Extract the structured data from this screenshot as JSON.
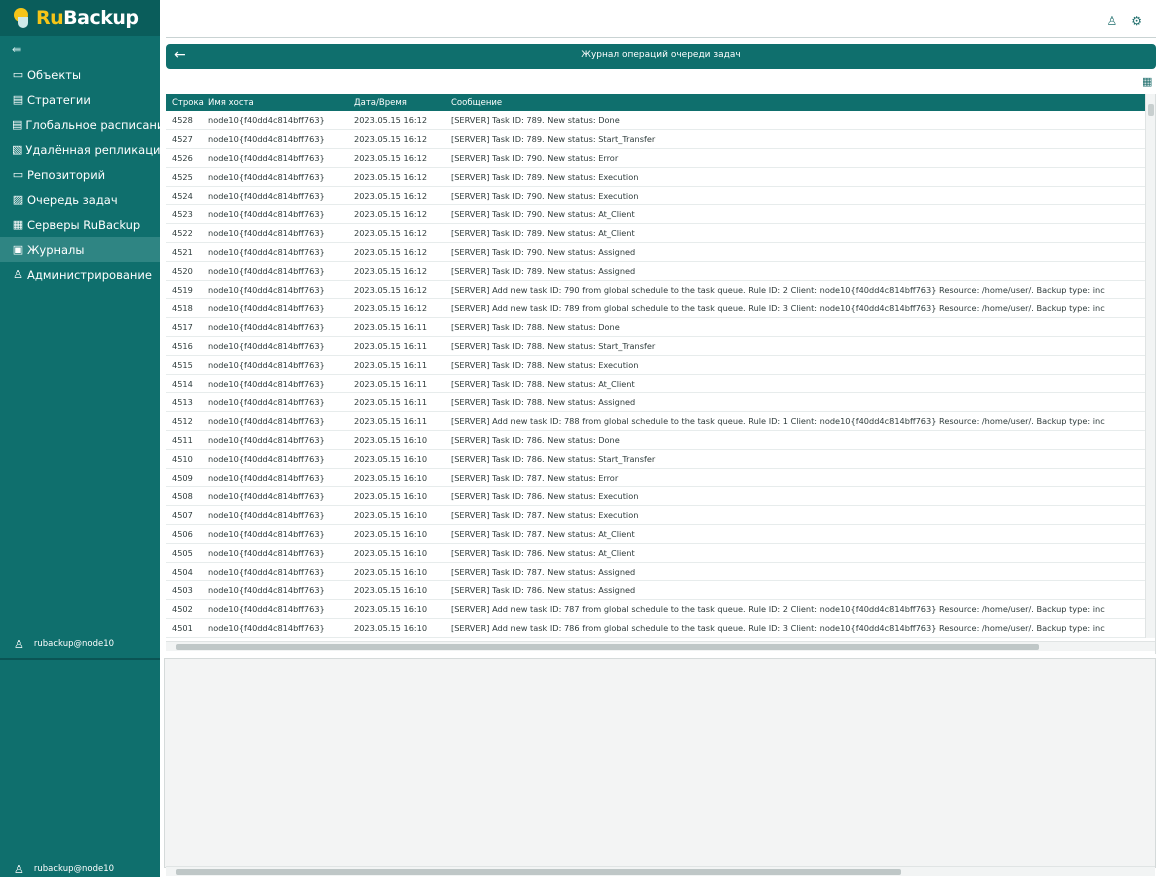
{
  "app": {
    "logo_ru": "Ru",
    "logo_backup": "Backup"
  },
  "sidebar": {
    "collapse_glyph": "⇚",
    "items": [
      {
        "icon": "monitor-icon",
        "glyph": "▭",
        "label": "Объекты"
      },
      {
        "icon": "strategy-icon",
        "glyph": "▤",
        "label": "Стратегии"
      },
      {
        "icon": "calendar-icon",
        "glyph": "▤",
        "label": "Глобальное расписание"
      },
      {
        "icon": "replication-icon",
        "glyph": "▧",
        "label": "Удалённая репликация"
      },
      {
        "icon": "repository-icon",
        "glyph": "▭",
        "label": "Репозиторий"
      },
      {
        "icon": "queue-icon",
        "glyph": "▨",
        "label": "Очередь задач"
      },
      {
        "icon": "servers-icon",
        "glyph": "▦",
        "label": "Серверы RuBackup"
      },
      {
        "icon": "journal-icon",
        "glyph": "▣",
        "label": "Журналы"
      },
      {
        "icon": "admin-icon",
        "glyph": "♙",
        "label": "Администрирование"
      }
    ],
    "user": "rubackup@node10"
  },
  "header": {
    "title": "Журнал операций очереди задач"
  },
  "table": {
    "columns": [
      "Строка",
      "Имя хоста",
      "Дата/Время",
      "Сообщение"
    ],
    "rows": [
      [
        "4528",
        "node10{f40dd4c814bff763}",
        "2023.05.15 16:12",
        "[SERVER] Task ID: 789. New status: Done"
      ],
      [
        "4527",
        "node10{f40dd4c814bff763}",
        "2023.05.15 16:12",
        "[SERVER] Task ID: 789. New status: Start_Transfer"
      ],
      [
        "4526",
        "node10{f40dd4c814bff763}",
        "2023.05.15 16:12",
        "[SERVER] Task ID: 790. New status: Error"
      ],
      [
        "4525",
        "node10{f40dd4c814bff763}",
        "2023.05.15 16:12",
        "[SERVER] Task ID: 789. New status: Execution"
      ],
      [
        "4524",
        "node10{f40dd4c814bff763}",
        "2023.05.15 16:12",
        "[SERVER] Task ID: 790. New status: Execution"
      ],
      [
        "4523",
        "node10{f40dd4c814bff763}",
        "2023.05.15 16:12",
        "[SERVER] Task ID: 790. New status: At_Client"
      ],
      [
        "4522",
        "node10{f40dd4c814bff763}",
        "2023.05.15 16:12",
        "[SERVER] Task ID: 789. New status: At_Client"
      ],
      [
        "4521",
        "node10{f40dd4c814bff763}",
        "2023.05.15 16:12",
        "[SERVER] Task ID: 790. New status: Assigned"
      ],
      [
        "4520",
        "node10{f40dd4c814bff763}",
        "2023.05.15 16:12",
        "[SERVER] Task ID: 789. New status: Assigned"
      ],
      [
        "4519",
        "node10{f40dd4c814bff763}",
        "2023.05.15 16:12",
        "[SERVER] Add new task ID: 790 from global schedule to the task queue. Rule ID: 2 Client: node10{f40dd4c814bff763} Resource: /home/user/. Backup type: inc"
      ],
      [
        "4518",
        "node10{f40dd4c814bff763}",
        "2023.05.15 16:12",
        "[SERVER] Add new task ID: 789 from global schedule to the task queue. Rule ID: 3 Client: node10{f40dd4c814bff763} Resource: /home/user/. Backup type: inc"
      ],
      [
        "4517",
        "node10{f40dd4c814bff763}",
        "2023.05.15 16:11",
        "[SERVER] Task ID: 788. New status: Done"
      ],
      [
        "4516",
        "node10{f40dd4c814bff763}",
        "2023.05.15 16:11",
        "[SERVER] Task ID: 788. New status: Start_Transfer"
      ],
      [
        "4515",
        "node10{f40dd4c814bff763}",
        "2023.05.15 16:11",
        "[SERVER] Task ID: 788. New status: Execution"
      ],
      [
        "4514",
        "node10{f40dd4c814bff763}",
        "2023.05.15 16:11",
        "[SERVER] Task ID: 788. New status: At_Client"
      ],
      [
        "4513",
        "node10{f40dd4c814bff763}",
        "2023.05.15 16:11",
        "[SERVER] Task ID: 788. New status: Assigned"
      ],
      [
        "4512",
        "node10{f40dd4c814bff763}",
        "2023.05.15 16:11",
        "[SERVER] Add new task ID: 788 from global schedule to the task queue. Rule ID: 1 Client: node10{f40dd4c814bff763} Resource: /home/user/. Backup type: inc"
      ],
      [
        "4511",
        "node10{f40dd4c814bff763}",
        "2023.05.15 16:10",
        "[SERVER] Task ID: 786. New status: Done"
      ],
      [
        "4510",
        "node10{f40dd4c814bff763}",
        "2023.05.15 16:10",
        "[SERVER] Task ID: 786. New status: Start_Transfer"
      ],
      [
        "4509",
        "node10{f40dd4c814bff763}",
        "2023.05.15 16:10",
        "[SERVER] Task ID: 787. New status: Error"
      ],
      [
        "4508",
        "node10{f40dd4c814bff763}",
        "2023.05.15 16:10",
        "[SERVER] Task ID: 786. New status: Execution"
      ],
      [
        "4507",
        "node10{f40dd4c814bff763}",
        "2023.05.15 16:10",
        "[SERVER] Task ID: 787. New status: Execution"
      ],
      [
        "4506",
        "node10{f40dd4c814bff763}",
        "2023.05.15 16:10",
        "[SERVER] Task ID: 787. New status: At_Client"
      ],
      [
        "4505",
        "node10{f40dd4c814bff763}",
        "2023.05.15 16:10",
        "[SERVER] Task ID: 786. New status: At_Client"
      ],
      [
        "4504",
        "node10{f40dd4c814bff763}",
        "2023.05.15 16:10",
        "[SERVER] Task ID: 787. New status: Assigned"
      ],
      [
        "4503",
        "node10{f40dd4c814bff763}",
        "2023.05.15 16:10",
        "[SERVER] Task ID: 786. New status: Assigned"
      ],
      [
        "4502",
        "node10{f40dd4c814bff763}",
        "2023.05.15 16:10",
        "[SERVER] Add new task ID: 787 from global schedule to the task queue. Rule ID: 2 Client: node10{f40dd4c814bff763} Resource: /home/user/. Backup type: inc"
      ],
      [
        "4501",
        "node10{f40dd4c814bff763}",
        "2023.05.15 16:10",
        "[SERVER] Add new task ID: 786 from global schedule to the task queue. Rule ID: 3 Client: node10{f40dd4c814bff763} Resource: /home/user/. Backup type: inc"
      ]
    ]
  }
}
